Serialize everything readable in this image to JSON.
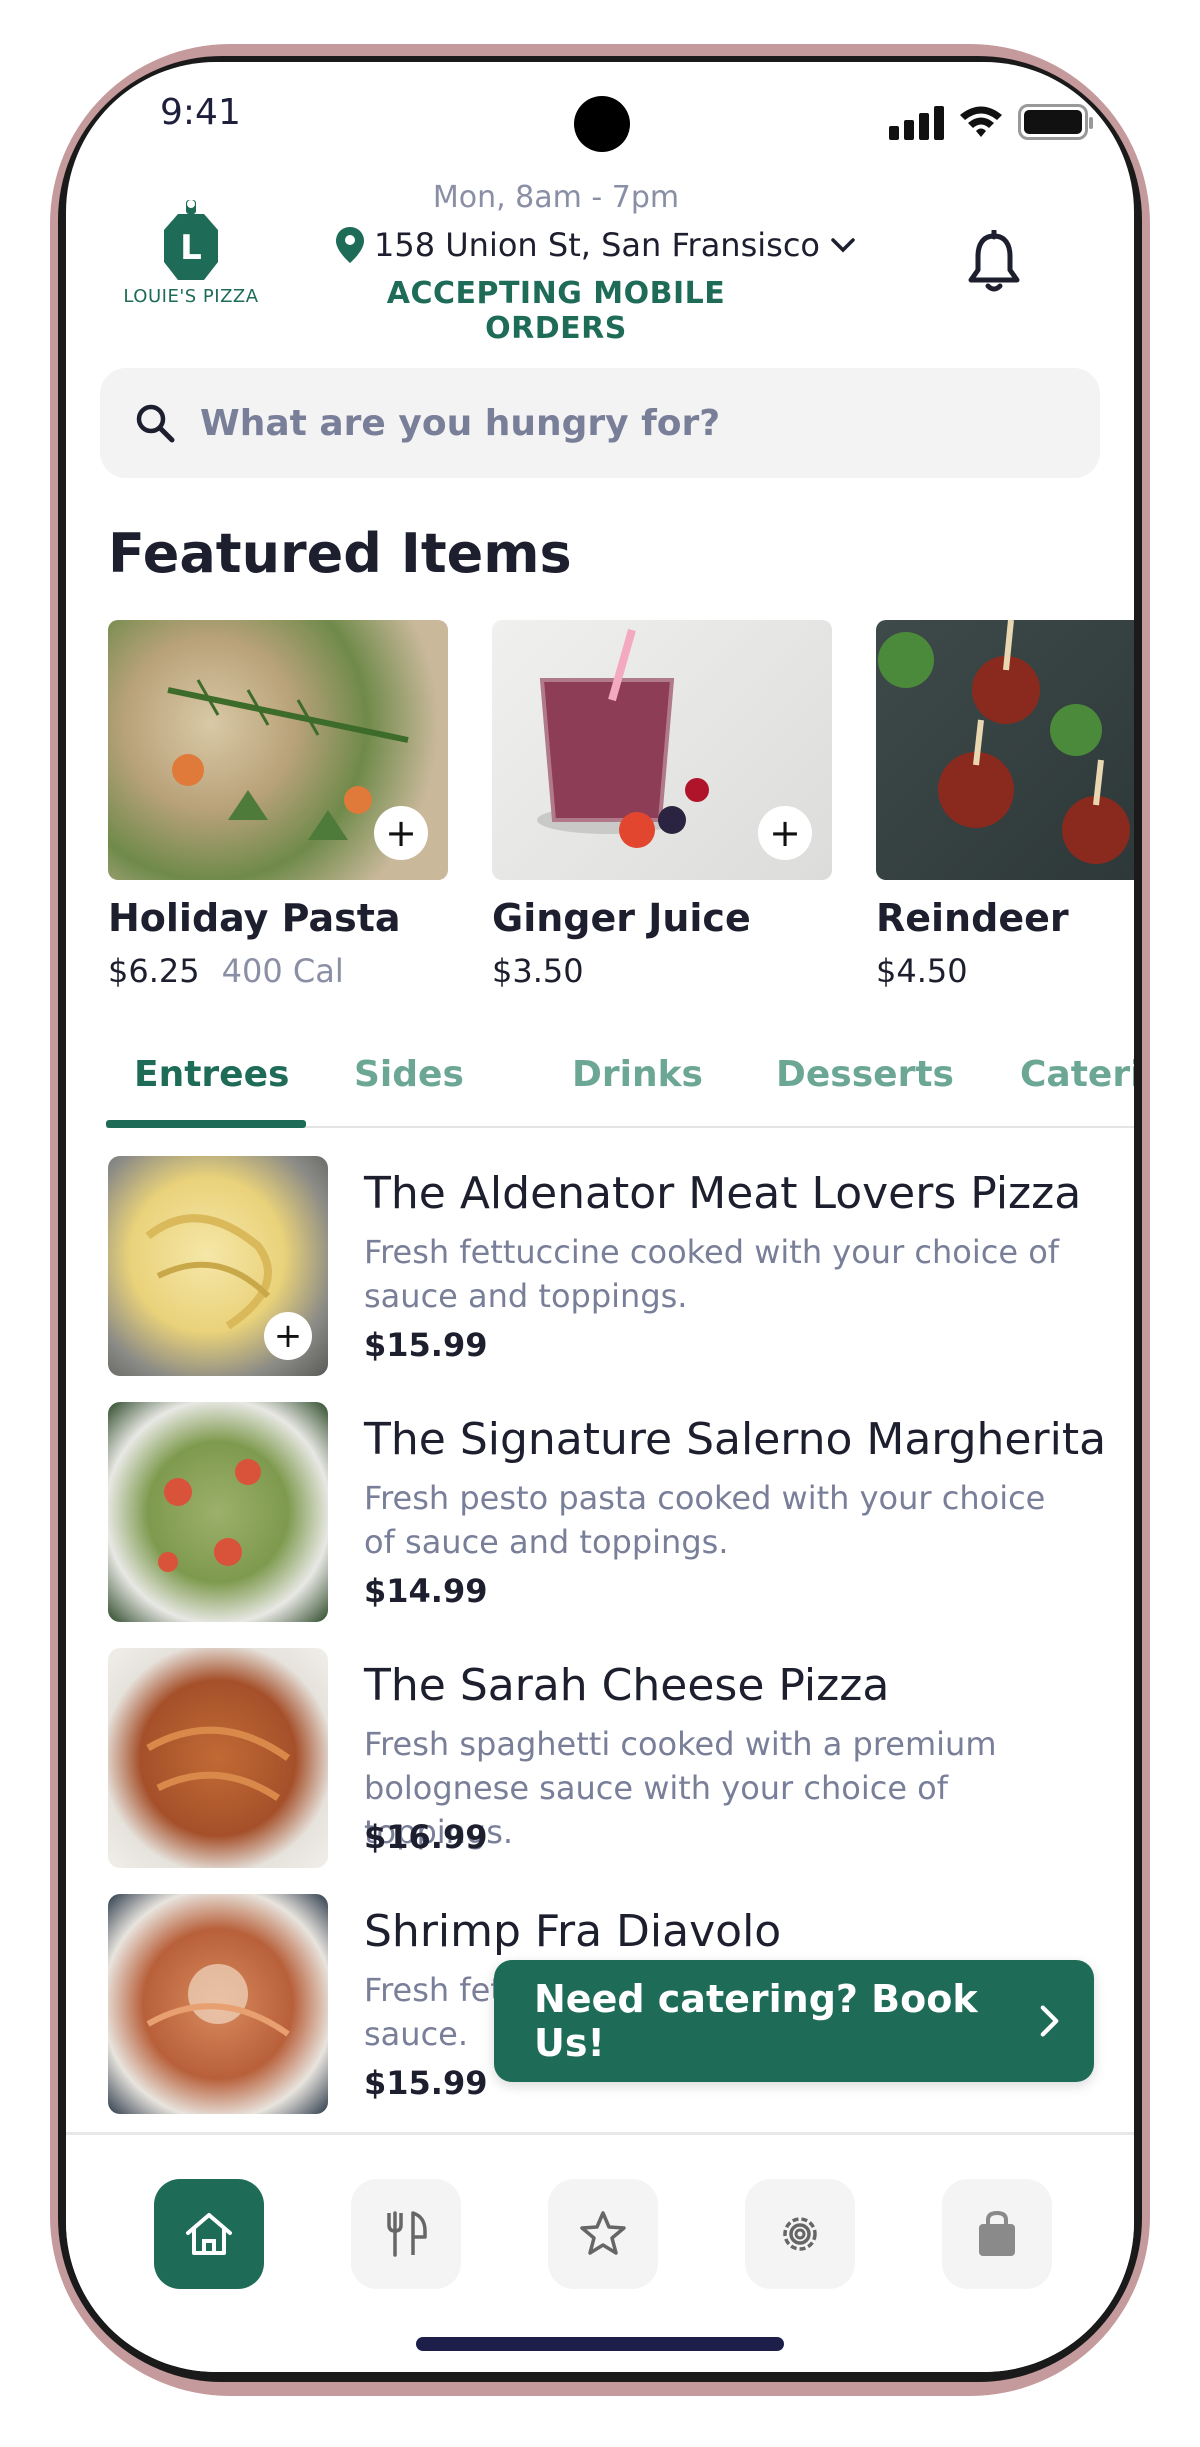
{
  "status_bar": {
    "time": "9:41"
  },
  "header": {
    "logo_text": "LOUIE'S PIZZA",
    "logo_letter": "L",
    "hours": "Mon, 8am - 7pm",
    "address": "158 Union St, San Fransisco",
    "status": "ACCEPTING MOBILE ORDERS"
  },
  "search": {
    "placeholder": "What are you hungry for?"
  },
  "featured": {
    "title": "Featured Items",
    "items": [
      {
        "name": "Holiday Pasta",
        "price": "$6.25",
        "calories": "400 Cal"
      },
      {
        "name": "Ginger Juice",
        "price": "$3.50"
      },
      {
        "name": "Reindeer",
        "price": "$4.50"
      }
    ]
  },
  "tabs": [
    "Entrees",
    "Sides",
    "Drinks",
    "Desserts",
    "Catering"
  ],
  "menu": [
    {
      "name": "The Aldenator Meat Lovers Pizza",
      "description": "Fresh fettuccine cooked with your choice of sauce and toppings.",
      "price": "$15.99"
    },
    {
      "name": "The Signature Salerno Margherita",
      "description": "Fresh pesto pasta cooked with your choice of sauce and toppings.",
      "price": "$14.99"
    },
    {
      "name": "The Sarah Cheese Pizza",
      "description": "Fresh spaghetti cooked with a premium bolognese sauce with your choice of toppings.",
      "price": "$16.99"
    },
    {
      "name": "Shrimp Fra Diavolo",
      "description": "Fresh fettuccine cooked with a fra diavolo sauce.",
      "price": "$15.99"
    }
  ],
  "catering_cta": {
    "label": "Need catering? Book Us!"
  },
  "bottom_nav": {
    "items": [
      {
        "icon": "home-icon",
        "active": true
      },
      {
        "icon": "utensils-icon",
        "active": false
      },
      {
        "icon": "star-icon",
        "active": false
      },
      {
        "icon": "gear-icon",
        "active": false
      },
      {
        "icon": "shopping-bag-icon",
        "active": false
      }
    ]
  },
  "colors": {
    "brand_green": "#1e6b57",
    "tab_inactive": "#6ba794",
    "muted_text": "#7a7f99",
    "frame": "#c59a9c"
  }
}
